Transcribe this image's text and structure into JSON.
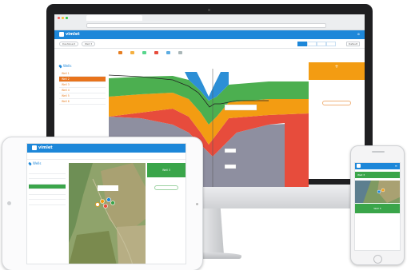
{
  "brand": {
    "name": "vimlet",
    "primary": "#1d87d9",
    "accent": "#e8731c",
    "green": "#3aa54a"
  },
  "desktop": {
    "browser_tab": "",
    "url": "",
    "header_links": [
      "",
      ""
    ],
    "subbar": {
      "back": "Dashboard",
      "well": "Well 3",
      "views": [
        "",
        "",
        "",
        ""
      ],
      "sort": "Default"
    },
    "sidebar": {
      "title": "Wells",
      "items": [
        "Well 1",
        "Well 2",
        "Well 3",
        "Well 4",
        "Well 5",
        "Well 6"
      ],
      "active_index": 1
    },
    "chart": {
      "markers": [
        "",
        "",
        "",
        "",
        ""
      ],
      "callouts": [
        "",
        "",
        ""
      ]
    },
    "right_panel": {
      "cta": "",
      "section1": "",
      "big_value": "",
      "rows": [
        [
          "",
          ""
        ],
        [
          "",
          ""
        ],
        [
          "",
          ""
        ],
        [
          "",
          ""
        ]
      ],
      "section2": "",
      "rows2": [
        [
          "",
          ""
        ],
        [
          "",
          ""
        ]
      ],
      "button": ""
    }
  },
  "tablet": {
    "app": "vimlet",
    "sidebar": {
      "title": "Wells",
      "items": [
        "",
        "",
        "",
        "",
        "",
        "",
        ""
      ],
      "active_index": 3
    },
    "map_popup": "",
    "panel_title": "Well 3",
    "rows": [
      [
        "",
        ""
      ],
      [
        "",
        ""
      ],
      [
        "",
        ""
      ]
    ],
    "button": "",
    "section": "",
    "rows2": [
      [
        "",
        ""
      ],
      [
        "",
        ""
      ],
      [
        "",
        ""
      ]
    ]
  },
  "phone": {
    "app": "vimlet",
    "well": "Well 3",
    "panel_title": "Well 3",
    "rows": [
      [
        "",
        ""
      ],
      [
        "",
        ""
      ],
      [
        "",
        ""
      ]
    ]
  },
  "icons": [
    "search-icon",
    "settings-icon",
    "user-icon",
    "location-pin-icon",
    "add-icon",
    "menu-icon"
  ]
}
